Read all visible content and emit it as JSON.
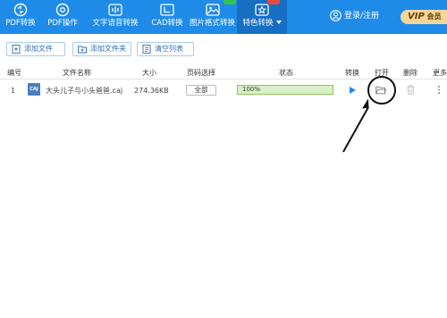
{
  "toolbar": {
    "items": [
      {
        "label": "PDF转换",
        "icon": "pdf-convert-icon"
      },
      {
        "label": "PDF操作",
        "icon": "pdf-operate-icon"
      },
      {
        "label": "文字语音转换",
        "icon": "text-voice-icon"
      },
      {
        "label": "CAD转换",
        "icon": "cad-icon"
      },
      {
        "label": "图片格式转换",
        "icon": "image-icon"
      },
      {
        "label": "特色转换",
        "icon": "star-icon"
      }
    ],
    "login_label": "登录/注册",
    "vip_prefix": "VIP",
    "vip_label": "会员",
    "colors": {
      "toolbar_bg": "#1f8be8",
      "active_bg": "#176fc4",
      "vip_bg": "#f4d69a"
    }
  },
  "actions": {
    "add_file": "添加文件",
    "add_folder": "添加文件夹",
    "clear_list": "清空列表"
  },
  "table": {
    "headers": {
      "index": "编号",
      "name": "文件名称",
      "size": "大小",
      "pages": "页码选择",
      "status": "状态",
      "convert": "转换",
      "open": "打开",
      "delete": "删除",
      "more": "更多"
    },
    "rows": [
      {
        "index": "1",
        "type": "CAJ",
        "name": "大头儿子与小头爸爸.caj",
        "size": "274.36KB",
        "pages": "全部",
        "progress_text": "100%",
        "progress": 1.0
      }
    ]
  }
}
